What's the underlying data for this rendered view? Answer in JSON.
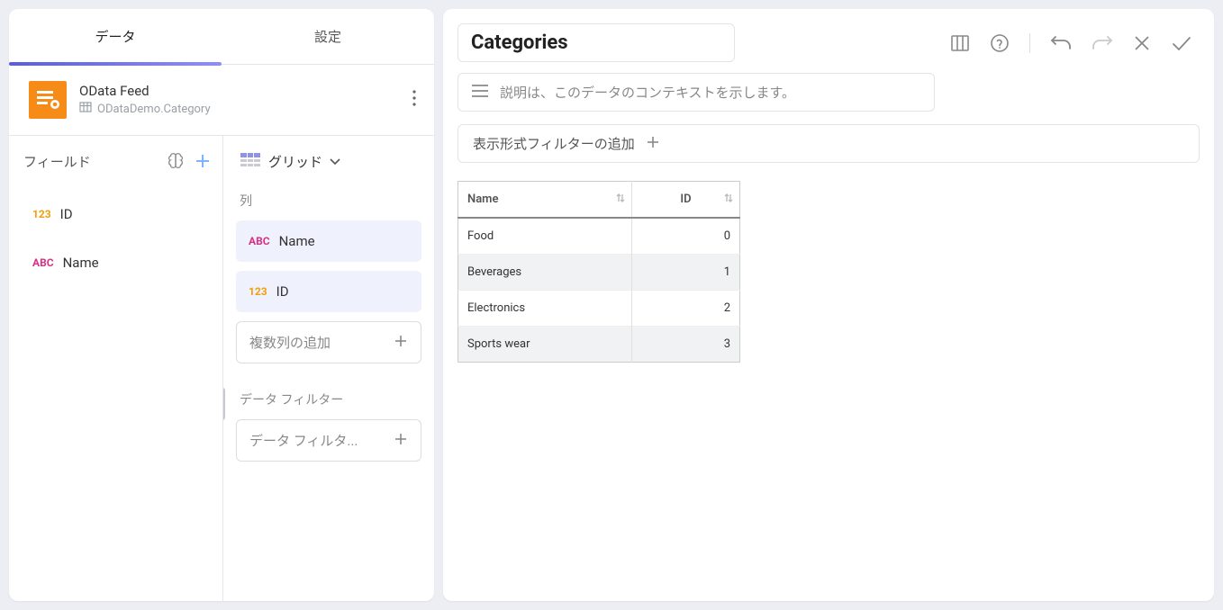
{
  "left": {
    "tabs": {
      "data": "データ",
      "settings": "設定"
    },
    "datasource": {
      "title": "OData Feed",
      "subtitle": "ODataDemo.Category"
    },
    "fields": {
      "header": "フィールド",
      "items": [
        {
          "type": "123",
          "label": "ID"
        },
        {
          "type": "ABC",
          "label": "Name"
        }
      ]
    },
    "config": {
      "visualization": "グリッド",
      "columns_label": "列",
      "columns": [
        {
          "type": "ABC",
          "label": "Name"
        },
        {
          "type": "123",
          "label": "ID"
        }
      ],
      "add_columns": "複数列の追加",
      "datafilters_label": "データ フィルター",
      "add_filter": "データ フィルタ..."
    }
  },
  "right": {
    "title": "Categories",
    "desc_placeholder": "説明は、このデータのコンテキストを示します。",
    "vis_filter_label": "表示形式フィルターの追加",
    "table": {
      "headers": {
        "name": "Name",
        "id": "ID"
      },
      "rows": [
        {
          "name": "Food",
          "id": "0"
        },
        {
          "name": "Beverages",
          "id": "1"
        },
        {
          "name": "Electronics",
          "id": "2"
        },
        {
          "name": "Sports wear",
          "id": "3"
        }
      ]
    }
  }
}
